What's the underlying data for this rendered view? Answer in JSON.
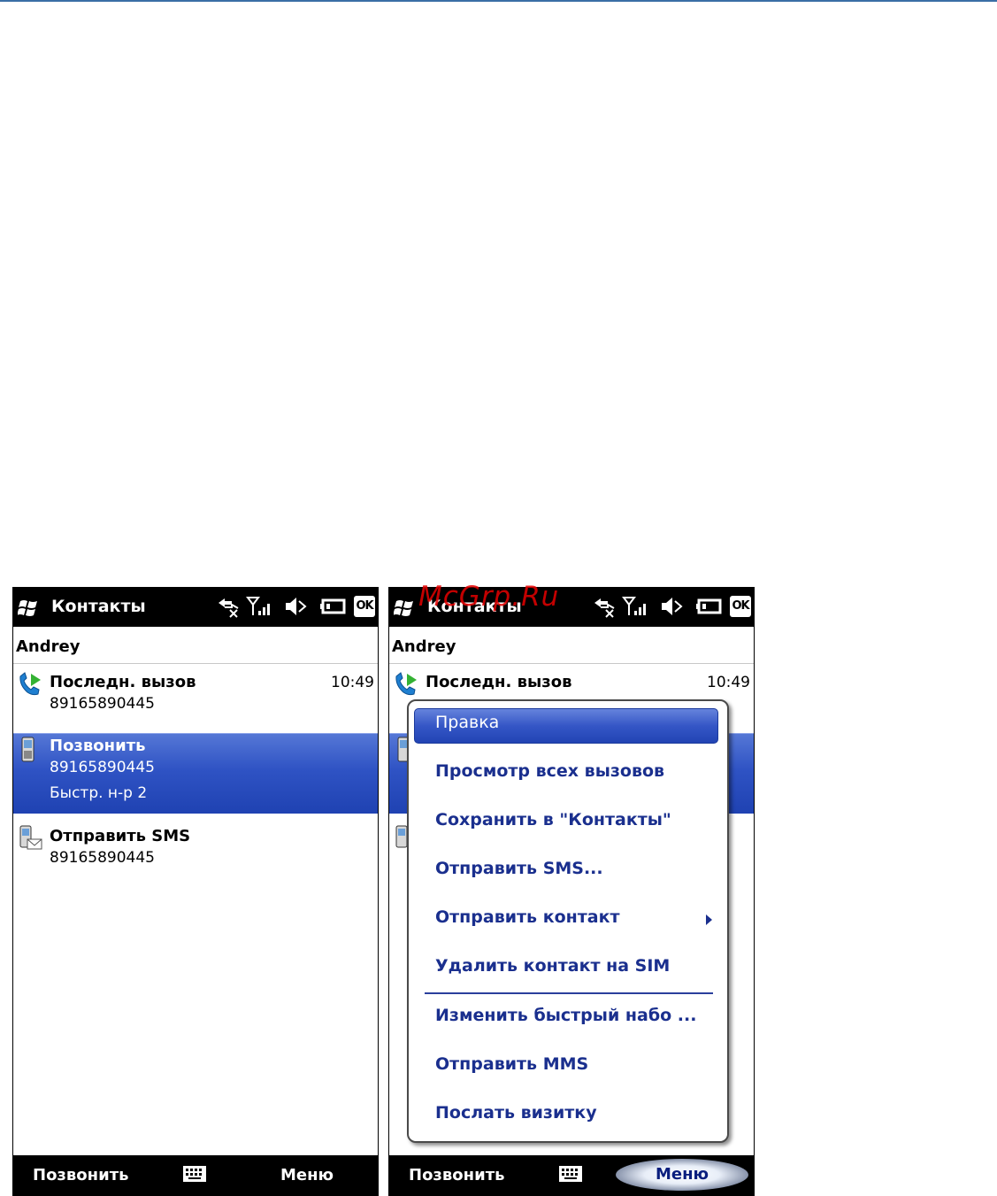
{
  "watermark": "McGrp.Ru",
  "screens": [
    {
      "status": {
        "title": "Контакты",
        "ok_label": "OK"
      },
      "contact_name": "Andrey",
      "rows": [
        {
          "title": "Последн. вызов",
          "number": "89165890445",
          "time": "10:49",
          "icon": "call-log-icon"
        },
        {
          "title": "Позвонить",
          "number": "89165890445",
          "extra": "Быстр. н-р 2",
          "icon": "mobile-phone-icon",
          "selected": true
        },
        {
          "title": "Отправить SMS",
          "number": "89165890445",
          "icon": "sms-icon"
        }
      ],
      "softkeys": {
        "left": "Позвонить",
        "right": "Меню"
      }
    },
    {
      "status": {
        "title": "Контакты",
        "ok_label": "OK"
      },
      "contact_name": "Andrey",
      "rows": [
        {
          "title": "Последн. вызов",
          "time": "10:49",
          "icon": "call-log-icon"
        }
      ],
      "menu": {
        "items": [
          "Правка",
          "Просмотр всех вызовов",
          "Сохранить в \"Контакты\"",
          "Отправить SMS...",
          "Отправить контакт",
          "Удалить контакт на SIM",
          "Изменить быстрый набо ...",
          "Отправить MMS",
          "Послать визитку"
        ],
        "highlighted_index": 0,
        "submenu_index": 4
      },
      "softkeys": {
        "left": "Позвонить",
        "right": "Меню"
      }
    }
  ],
  "colors": {
    "selection": "#2f53c4",
    "menu_text": "#1a2f8e",
    "status_bar": "#000000"
  }
}
